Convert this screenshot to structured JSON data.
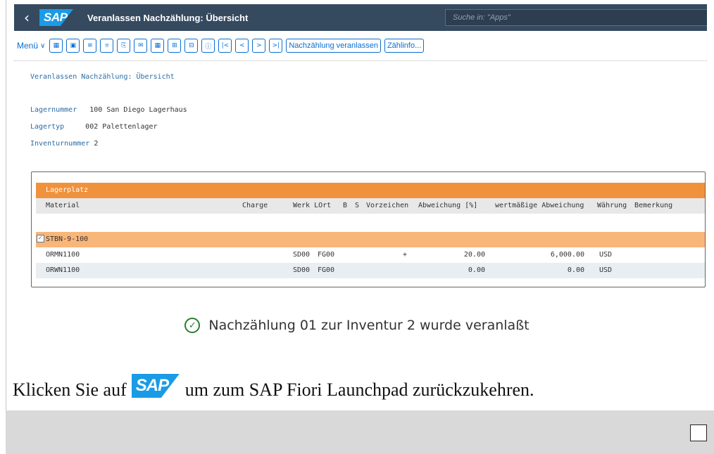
{
  "shell": {
    "back_glyph": "‹",
    "logo_text": "SAP",
    "title": "Veranlassen Nachzählung: Übersicht",
    "search_placeholder": "Suche in: \"Apps\""
  },
  "toolbar": {
    "menu_label": "Menü",
    "icon_buttons": [
      {
        "name": "layout-icon",
        "glyph": "▦"
      },
      {
        "name": "select-layout-icon",
        "glyph": "▣"
      },
      {
        "name": "sort-icon",
        "glyph": "≡"
      },
      {
        "name": "filter-icon",
        "glyph": "⩸"
      },
      {
        "name": "export-icon",
        "glyph": "⎘"
      },
      {
        "name": "mail-icon",
        "glyph": "✉"
      },
      {
        "name": "table-icon",
        "glyph": "▦"
      },
      {
        "name": "subtotal-icon",
        "glyph": "⊞"
      },
      {
        "name": "total-icon",
        "glyph": "⊟"
      },
      {
        "name": "info-icon",
        "glyph": "ⓘ"
      },
      {
        "name": "first-page-icon",
        "glyph": "|<"
      },
      {
        "name": "prev-page-icon",
        "glyph": "<"
      },
      {
        "name": "next-page-icon",
        "glyph": ">"
      },
      {
        "name": "last-page-icon",
        "glyph": ">|"
      }
    ],
    "action_buttons": [
      "Nachzählung veranlassen",
      "Zählinfo..."
    ]
  },
  "report": {
    "title": "Veranlassen Nachzählung: Übersicht",
    "fields": [
      {
        "label": "Lagernummer",
        "value": "100 San Diego Lagerhaus"
      },
      {
        "label": "Lagertyp",
        "value": "002 Palettenlager"
      },
      {
        "label": "Inventurnummer",
        "value": "2"
      }
    ]
  },
  "list": {
    "header_group": "Lagerplatz",
    "columns": {
      "material": "Material",
      "charge": "Charge",
      "werk_lort": "Werk LOrt",
      "b": "B",
      "s": "S",
      "vorzeichen": "Vorzeichen",
      "abweichung": "Abweichung [%]",
      "wert_abweichung": "wertmäßige Abweichung",
      "waehrung": "Währung",
      "bemerkung": "Bemerkung"
    },
    "group": {
      "checked": true,
      "label": "STBN-9-100"
    },
    "rows": [
      {
        "material": "ORMN1100",
        "werk": "SD00",
        "lort": "FG00",
        "vorzeichen": "+",
        "abweichung": "20.00",
        "wert": "6,000.00",
        "waehrung": "USD"
      },
      {
        "material": "ORWN1100",
        "werk": "SD00",
        "lort": "FG00",
        "vorzeichen": "",
        "abweichung": "0.00",
        "wert": "0.00",
        "waehrung": "USD"
      }
    ]
  },
  "message": {
    "icon": "check-circle-icon",
    "text": "Nachzählung 01 zur Inventur 2 wurde veranlaßt"
  },
  "instruction": {
    "before": "Klicken Sie auf",
    "logo_text": "SAP",
    "after": "um zum SAP Fiori Launchpad zurückzukehren."
  },
  "colors": {
    "shell": "#354a5f",
    "accent": "#0a6ed1",
    "list_header": "#f0923c",
    "group_row": "#f9b679",
    "label_blue": "#2b6ca3",
    "success": "#2b7d2b"
  }
}
